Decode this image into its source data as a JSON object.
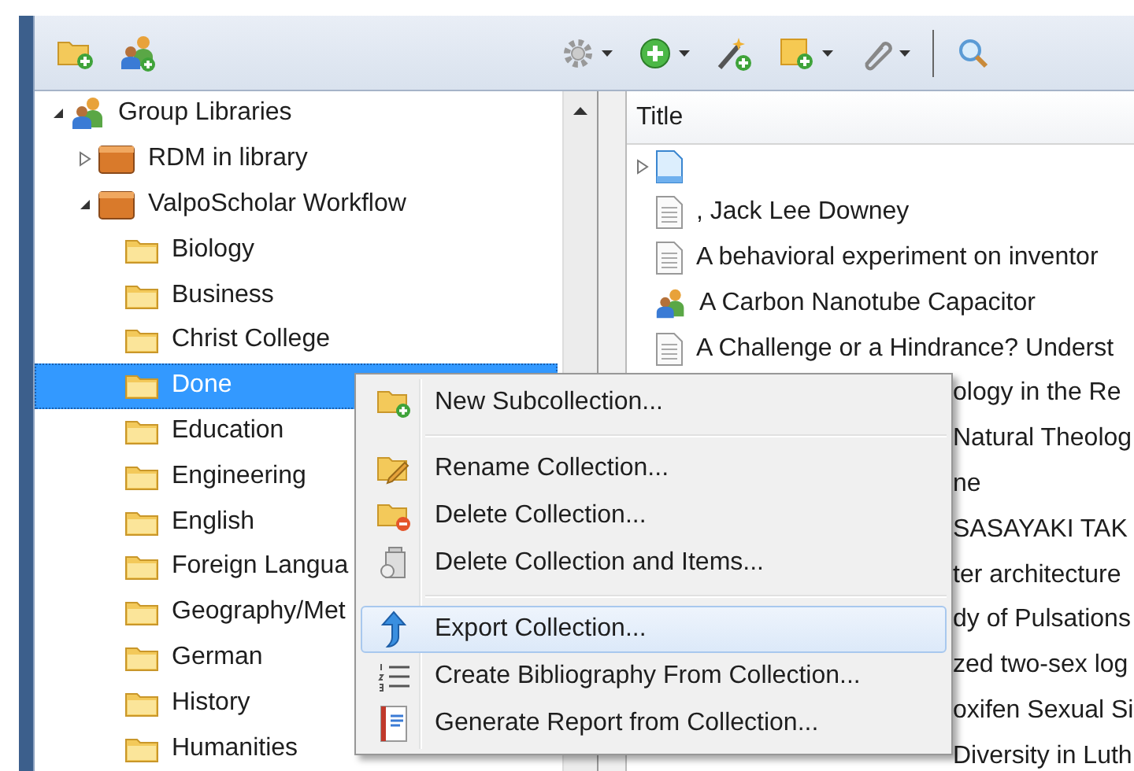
{
  "tree": {
    "items": [
      {
        "label": "Group Libraries",
        "kind": "group",
        "expanded": true,
        "selected": false,
        "children": [
          {
            "label": "RDM in library",
            "kind": "library",
            "expanded": false,
            "selected": false
          },
          {
            "label": "ValpoScholar Workflow",
            "kind": "library",
            "expanded": true,
            "selected": false,
            "children": [
              {
                "label": "Biology",
                "kind": "folder",
                "selected": false
              },
              {
                "label": "Business",
                "kind": "folder",
                "selected": false
              },
              {
                "label": "Christ College",
                "kind": "folder",
                "selected": false
              },
              {
                "label": "Done",
                "kind": "folder",
                "selected": true
              },
              {
                "label": "Education",
                "kind": "folder",
                "selected": false
              },
              {
                "label": "Engineering",
                "kind": "folder",
                "selected": false
              },
              {
                "label": "English",
                "kind": "folder",
                "selected": false
              },
              {
                "label": "Foreign Langua",
                "kind": "folder",
                "selected": false
              },
              {
                "label": "Geography/Met",
                "kind": "folder",
                "selected": false
              },
              {
                "label": "German",
                "kind": "folder",
                "selected": false
              },
              {
                "label": "History",
                "kind": "folder",
                "selected": false
              },
              {
                "label": "Humanities",
                "kind": "folder",
                "selected": false
              }
            ]
          }
        ]
      }
    ]
  },
  "items": {
    "columns": [
      {
        "label": "Title"
      }
    ],
    "rows": [
      {
        "kind": "note",
        "expanded": false
      },
      {
        "kind": "document",
        "title": ", Jack Lee Downey"
      },
      {
        "kind": "document",
        "title": "A behavioral experiment on inventor"
      },
      {
        "kind": "presentation",
        "title": "A Carbon Nanotube Capacitor"
      },
      {
        "kind": "document",
        "title": "A Challenge or a Hindrance? Underst"
      },
      {
        "kind": "covered",
        "title": "ology in the Re"
      },
      {
        "kind": "covered",
        "title": "Natural Theolog"
      },
      {
        "kind": "covered",
        "title": "ne"
      },
      {
        "kind": "covered",
        "title": "SASAYAKI TAK"
      },
      {
        "kind": "covered",
        "title": "ter architecture"
      },
      {
        "kind": "covered",
        "title": "dy of Pulsations"
      },
      {
        "kind": "covered",
        "title": "zed two-sex log"
      },
      {
        "kind": "covered",
        "title": "oxifen Sexual Si"
      },
      {
        "kind": "covered",
        "title": "Diversity in Luth"
      }
    ]
  },
  "context_menu": {
    "items": [
      {
        "kind": "item",
        "label": "New Subcollection...",
        "selected": false
      },
      {
        "kind": "separator"
      },
      {
        "kind": "item",
        "label": "Rename Collection...",
        "selected": false
      },
      {
        "kind": "item",
        "label": "Delete Collection...",
        "selected": false
      },
      {
        "kind": "item",
        "label": "Delete Collection and Items...",
        "selected": false
      },
      {
        "kind": "separator"
      },
      {
        "kind": "item",
        "label": "Export Collection...",
        "selected": true
      },
      {
        "kind": "item",
        "label": "Create Bibliography From Collection...",
        "selected": false
      },
      {
        "kind": "item",
        "label": "Generate Report from Collection...",
        "selected": false
      }
    ]
  }
}
